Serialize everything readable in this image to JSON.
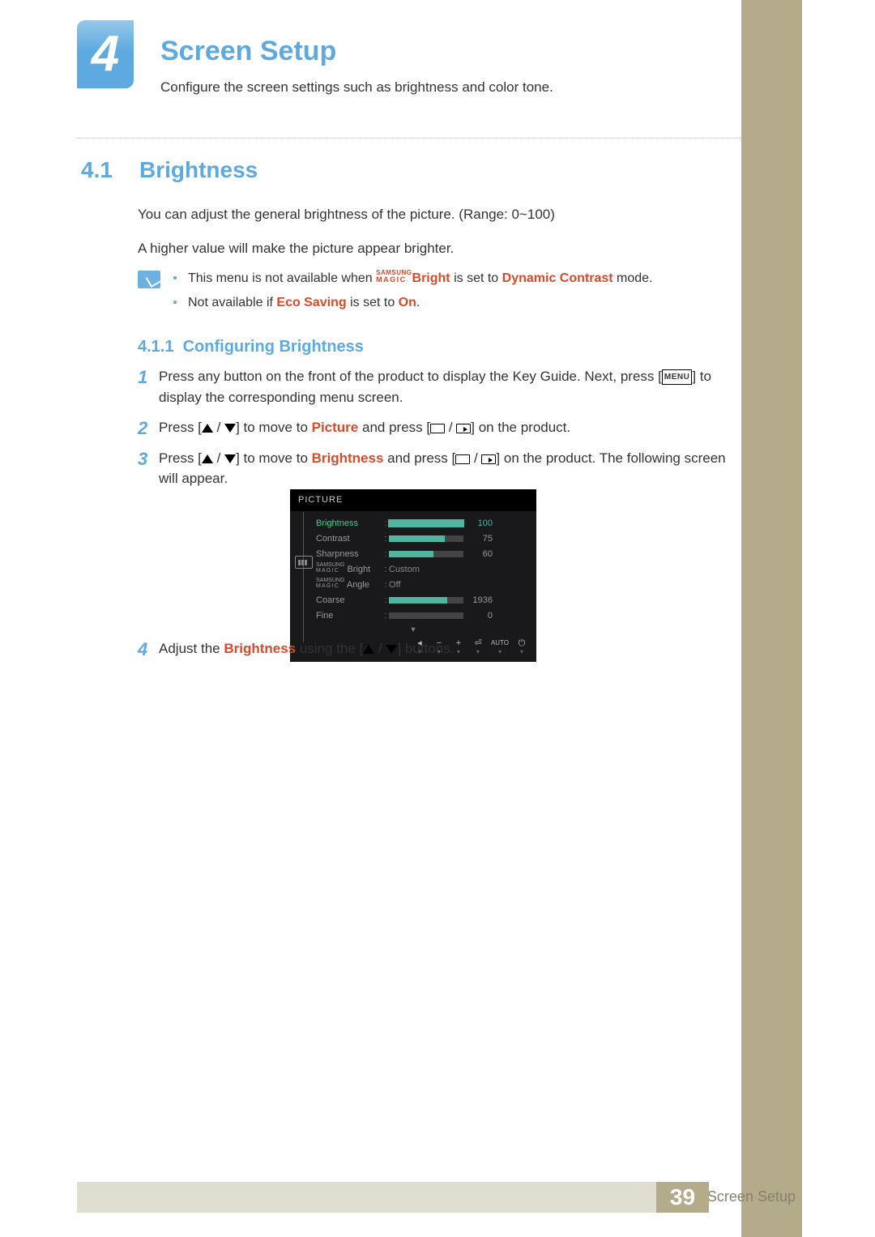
{
  "chapter": {
    "number": "4",
    "title": "Screen Setup",
    "intro": "Configure the screen settings such as brightness and color tone."
  },
  "section": {
    "number": "4.1",
    "title": "Brightness"
  },
  "para1": "You can adjust the general brightness of the picture. (Range: 0~100)",
  "para2": "A higher value will make the picture appear brighter.",
  "notes": {
    "line1a": "This menu is not available when ",
    "line1_magic_top": "SAMSUNG",
    "line1_magic_bot": "MAGIC",
    "line1_bright": "Bright",
    "line1b": " is set to ",
    "line1_dc": "Dynamic Contrast",
    "line1c": " mode.",
    "line2a": "Not available if ",
    "line2_eco": "Eco Saving",
    "line2b": " is set to ",
    "line2_on": "On",
    "line2c": "."
  },
  "subsection": {
    "number": "4.1.1",
    "title": "Configuring Brightness"
  },
  "steps": {
    "s1a": "Press any button on the front of the product to display the Key Guide. Next, press [",
    "s1_menu": "MENU",
    "s1b": "] to display the corresponding menu screen.",
    "s2a": "Press [",
    "s2b": "] to move to ",
    "s2_pic": "Picture",
    "s2c": " and press [",
    "s2d": "] on the product.",
    "s3a": "Press [",
    "s3b": "] to move to ",
    "s3_bri": "Brightness",
    "s3c": " and press [",
    "s3d": "] on the product. The following screen will appear.",
    "s4a": "Adjust the ",
    "s4_bri": "Brightness",
    "s4b": " using the [",
    "s4c": "] buttons."
  },
  "osd": {
    "title": "PICTURE",
    "rows": [
      {
        "label": "Brightness",
        "value": "100",
        "fill": 100,
        "selected": true,
        "type": "bar"
      },
      {
        "label": "Contrast",
        "value": "75",
        "fill": 75,
        "type": "bar"
      },
      {
        "label": "Sharpness",
        "value": "60",
        "fill": 60,
        "type": "bar"
      },
      {
        "label_magic_top": "SAMSUNG",
        "label_magic_bot": "MAGIC",
        "label_suffix": " Bright",
        "text": "Custom",
        "type": "text"
      },
      {
        "label_magic_top": "SAMSUNG",
        "label_magic_bot": "MAGIC",
        "label_suffix": " Angle",
        "text": "Off",
        "type": "text"
      },
      {
        "label": "Coarse",
        "value": "1936",
        "fill": 78,
        "type": "bar"
      },
      {
        "label": "Fine",
        "value": "0",
        "fill": 0,
        "type": "bar"
      }
    ],
    "footer_auto": "AUTO"
  },
  "footer": {
    "chapter_label": "4 Screen Setup",
    "page": "39"
  }
}
